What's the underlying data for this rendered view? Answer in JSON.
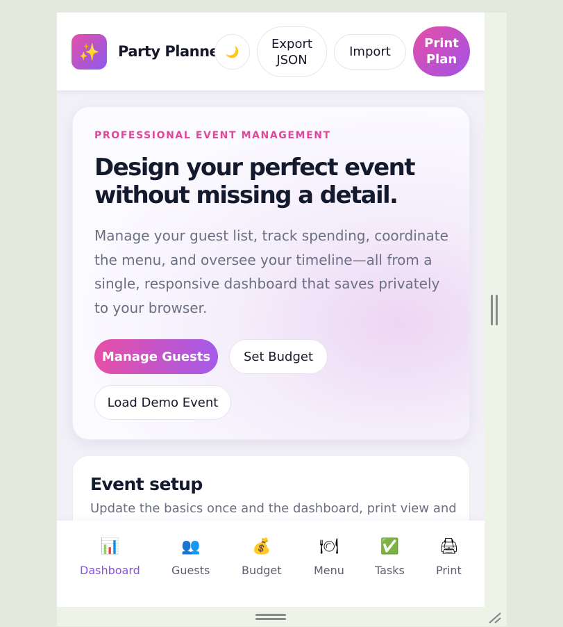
{
  "app": {
    "title": "Party Planner",
    "logo_icon": "sparkles-icon"
  },
  "header": {
    "theme_toggle_icon": "🌙",
    "export_label": "Export JSON",
    "import_label": "Import",
    "print_label": "Print Plan"
  },
  "hero": {
    "eyebrow": "PROFESSIONAL EVENT MANAGEMENT",
    "headline": "Design your perfect event without missing a detail.",
    "description": "Manage your guest list, track spending, coordinate the menu, and oversee your timeline—all from a single, responsive dashboard that saves privately to your browser.",
    "buttons": {
      "manage_guests": "Manage Guests",
      "set_budget": "Set Budget",
      "load_demo": "Load Demo Event"
    }
  },
  "setup": {
    "title": "Event setup",
    "description": "Update the basics once and the dashboard, print view and"
  },
  "nav": {
    "items": [
      {
        "label": "Dashboard",
        "icon": "📊",
        "active": true
      },
      {
        "label": "Guests",
        "icon": "👥",
        "active": false
      },
      {
        "label": "Budget",
        "icon": "💰",
        "active": false
      },
      {
        "label": "Menu",
        "icon": "🍽",
        "active": false
      },
      {
        "label": "Tasks",
        "icon": "✅",
        "active": false
      },
      {
        "label": "Print",
        "icon": "🖨",
        "active": false
      }
    ]
  },
  "colors": {
    "accent_pink": "#e64fa6",
    "accent_purple": "#8a5af0",
    "active_nav": "#8a4ff0"
  }
}
